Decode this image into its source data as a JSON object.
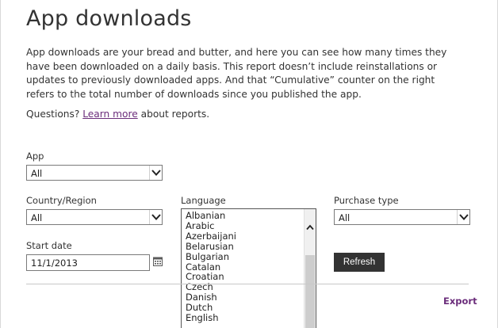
{
  "page": {
    "title": "App downloads",
    "intro": "App downloads are your bread and butter, and here you can see how many times they have been downloaded on a daily basis. This report doesn’t include reinstallations or updates to previously downloaded apps. And that “Cumulative” counter on the right refers to the total number of downloads since you published the app.",
    "questions_prefix": "Questions?",
    "learn_more": "Learn more",
    "questions_suffix": "about reports."
  },
  "filters": {
    "app": {
      "label": "App",
      "value": "All"
    },
    "country": {
      "label": "Country/Region",
      "value": "All"
    },
    "language": {
      "label": "Language",
      "options": [
        "Albanian",
        "Arabic",
        "Azerbaijani",
        "Belarusian",
        "Bulgarian",
        "Catalan",
        "Croatian",
        "Czech",
        "Danish",
        "Dutch",
        "English"
      ]
    },
    "purchase": {
      "label": "Purchase type",
      "value": "All"
    },
    "start_date": {
      "label": "Start date",
      "value": "11/1/2013"
    }
  },
  "actions": {
    "refresh": "Refresh",
    "export": "Export"
  },
  "colors": {
    "link": "#6b2d7b",
    "button_bg": "#333333",
    "text": "#333333"
  }
}
